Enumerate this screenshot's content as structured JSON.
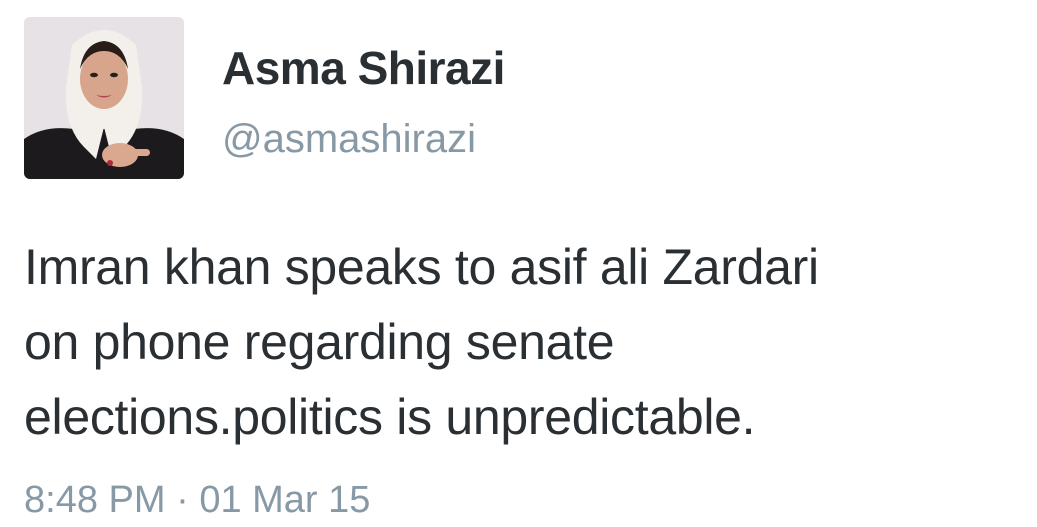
{
  "tweet": {
    "avatar_icon": "profile-photo",
    "display_name": "Asma Shirazi",
    "screen_name": "@asmashirazi",
    "text_lines": [
      "Imran khan speaks to asif ali Zardari",
      "on phone regarding senate",
      "elections.politics is unpredictable."
    ],
    "time": "8:48 PM",
    "separator": "·",
    "date": "01 Mar 15"
  },
  "colors": {
    "text": "#292f33",
    "secondary": "#8899a6",
    "background": "#ffffff"
  }
}
